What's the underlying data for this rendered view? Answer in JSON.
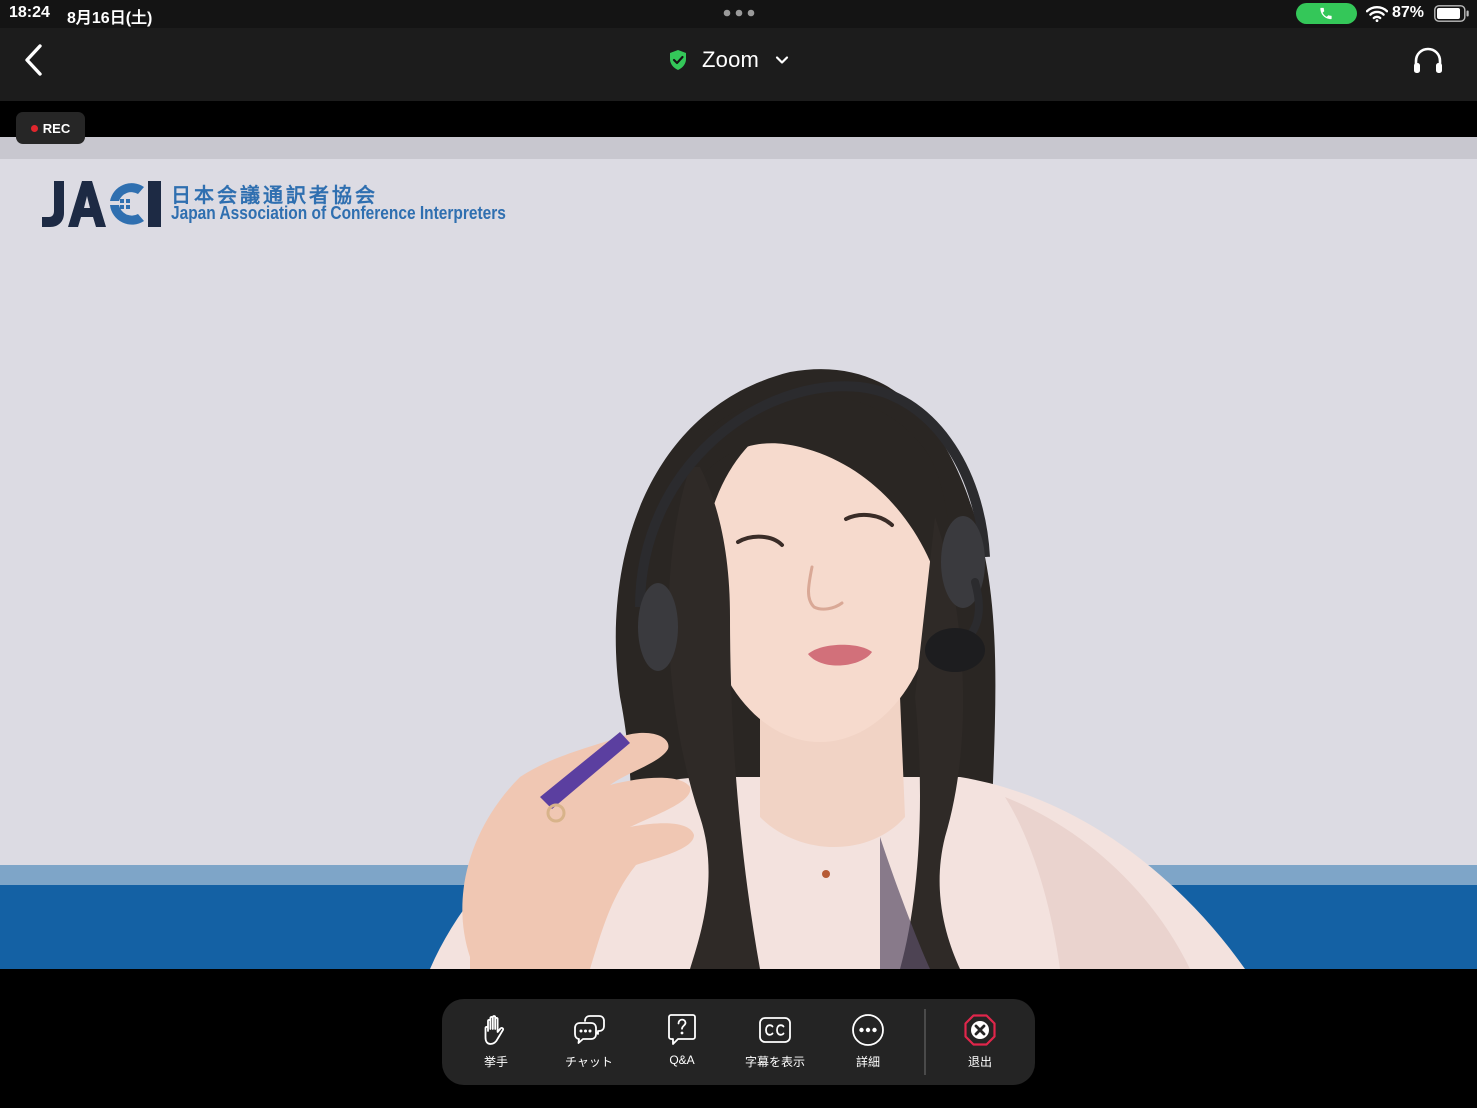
{
  "status_bar": {
    "time": "18:24",
    "date": "8月16日(土)",
    "battery": "87%",
    "call_indicator_color": "#34c759"
  },
  "nav": {
    "title": "Zoom",
    "security_icon_color": "#34c759",
    "icons": [
      "back-chevron-icon",
      "shield-check-icon",
      "chevron-down-icon",
      "headphones-icon"
    ]
  },
  "recording": {
    "label": "REC",
    "dot_color": "#e0262d"
  },
  "video": {
    "logo_mark": "JACI",
    "logo_ja": "日本会議通訳者協会",
    "logo_en": "Japan Association of Conference Interpreters",
    "brand_color": "#1461a4",
    "background_color": "#dcdbe3"
  },
  "toolbar": {
    "raise_hand": {
      "label": "挙手",
      "icon": "hand-icon"
    },
    "chat": {
      "label": "チャット",
      "icon": "chat-bubble-icon"
    },
    "qa": {
      "label": "Q&A",
      "icon": "question-box-icon"
    },
    "captions": {
      "label": "字幕を表示",
      "icon": "cc-icon"
    },
    "more": {
      "label": "詳細",
      "icon": "more-dots-icon"
    },
    "leave": {
      "label": "退出",
      "icon": "leave-x-icon",
      "accent_color": "#e0264b"
    }
  }
}
